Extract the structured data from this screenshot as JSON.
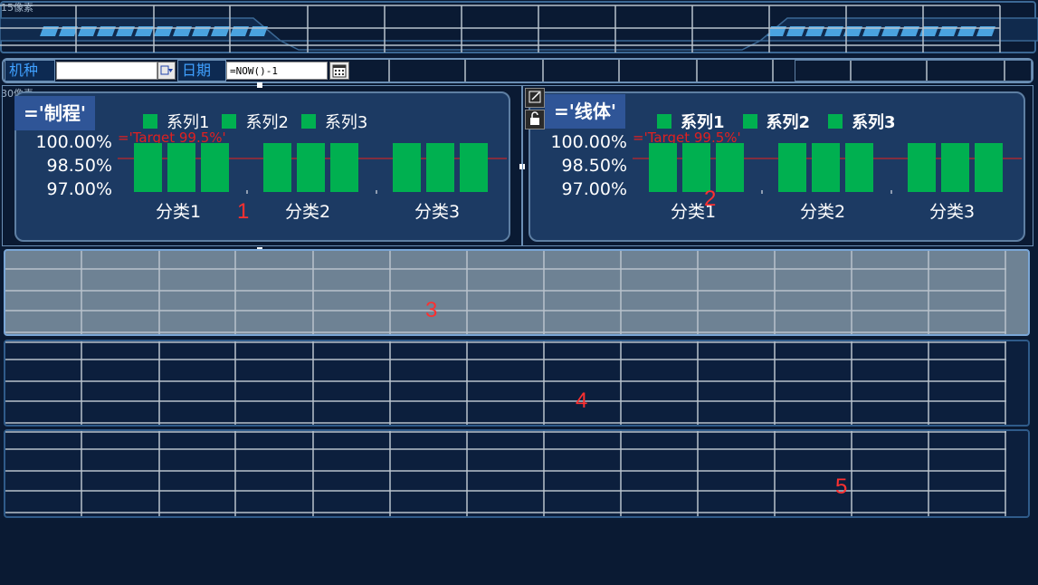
{
  "header": {
    "top_pixel_label": "15像素",
    "mid_pixel_label": "30像素"
  },
  "filters": {
    "model_label": "机种",
    "model_value": "",
    "date_label": "日期",
    "date_value": "=NOW()-1"
  },
  "chart_data": [
    {
      "type": "bar",
      "title": "='制程'",
      "categories": [
        "分类1",
        "分类2",
        "分类3"
      ],
      "series": [
        {
          "name": "系列1",
          "values": [
            100,
            100,
            100
          ]
        },
        {
          "name": "系列2",
          "values": [
            100,
            100,
            100
          ]
        },
        {
          "name": "系列3",
          "values": [
            100,
            100,
            100
          ]
        }
      ],
      "yticks": [
        "100.00%",
        "98.50%",
        "97.00%"
      ],
      "target_label": "='Target 99.5%'",
      "target_value": 99.5,
      "ylim": [
        97,
        100
      ],
      "legend": "top",
      "color": "#00b050"
    },
    {
      "type": "bar",
      "title": "='线体'",
      "categories": [
        "分类1",
        "分类2",
        "分类3"
      ],
      "series": [
        {
          "name": "系列1",
          "values": [
            100,
            100,
            100
          ]
        },
        {
          "name": "系列2",
          "values": [
            100,
            100,
            100
          ]
        },
        {
          "name": "系列3",
          "values": [
            100,
            100,
            100
          ]
        }
      ],
      "yticks": [
        "100.00%",
        "98.50%",
        "97.00%"
      ],
      "target_label": "='Target 99.5%'",
      "target_value": 99.5,
      "ylim": [
        97,
        100
      ],
      "legend": "top",
      "color": "#00b050"
    }
  ],
  "region_numbers": [
    "1",
    "2",
    "3",
    "4",
    "5"
  ],
  "toolbar": {
    "edit_icon": "edit-icon",
    "lock_icon": "lock-icon"
  }
}
